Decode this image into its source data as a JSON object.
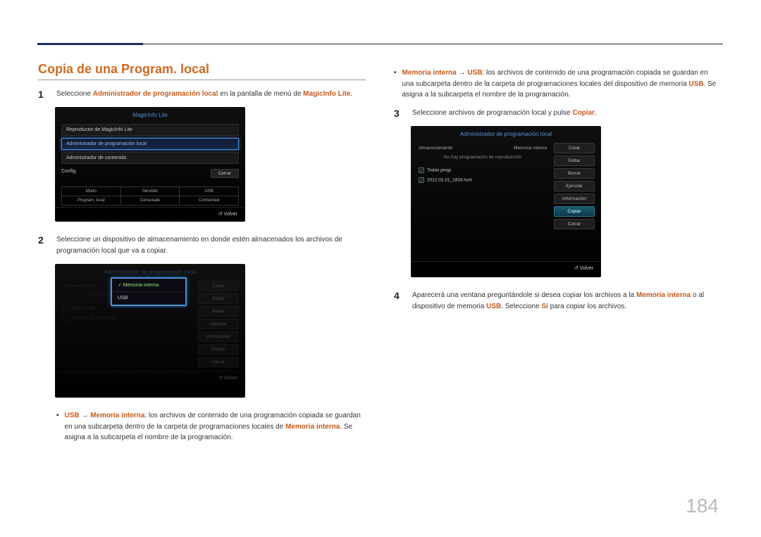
{
  "page_number": "184",
  "section_title": "Copia de una Program. local",
  "steps": {
    "s1_prefix": "Seleccione ",
    "s1_bold1": "Administrador de programación local",
    "s1_mid": " en la pantalla de menú de ",
    "s1_bold2": "MagicInfo Lite",
    "s1_end": ".",
    "s2": "Seleccione un dispositivo de almacenamiento en donde estén almacenados los archivos de programación local que va a copiar.",
    "s3_prefix": "Seleccione archivos de programación local y pulse ",
    "s3_copiar": "Copiar",
    "s3_end": ".",
    "s4_prefix": "Aparecerá una ventana preguntándole si desea copiar los archivos a la ",
    "s4_mem": "Memoria interna",
    "s4_mid": " o al dispositivo de memoria ",
    "s4_usb": "USB",
    "s4_mid2": ". Seleccione ",
    "s4_si": "Sí",
    "s4_end": " para copiar los archivos."
  },
  "bullets": {
    "b1_lead": "USB",
    "b1_arrow": " → ",
    "b1_target": "Memoria interna",
    "b1_rest": ": los archivos de contenido de una programación copiada se guardan en una subcarpeta dentro de la carpeta de programaciones locales de ",
    "b1_mem2": "Memoria interna",
    "b1_end": ". Se asigna a la subcarpeta el nombre de la programación.",
    "b2_lead": "Memoria interna",
    "b2_arrow": " → ",
    "b2_target": "USB",
    "b2_rest": ": los archivos de contenido de una programación copiada se guardan en una subcarpeta dentro de la carpeta de programaciones locales del dispositivo de memoria ",
    "b2_usb2": "USB",
    "b2_end": ". Se asigna a la subcarpeta el nombre de la programación."
  },
  "shot1": {
    "title": "MagicInfo Lite",
    "row1": "Reproductor de MagicInfo Lite",
    "row2": "Administrador de programación local",
    "row3": "Administrador de contenido",
    "row4": "Config.",
    "btn_cerrar": "Cerrar",
    "status_h": [
      "Modo",
      "Servidor",
      "USB"
    ],
    "status_v": [
      "Program. local",
      "Conectado",
      "Connected"
    ],
    "volver": "Volver"
  },
  "shot2": {
    "title": "Administrador de programación local",
    "hdr_left": "Almacenamiento",
    "hdr_right": "Memoria interna",
    "sub": "No hay programación de reproducción",
    "opt_all": "Todas progr.",
    "opt_file": "2012.01.01_1834.lsch",
    "pop_mem": "Memoria interna",
    "pop_usb": "USB",
    "btns": [
      "Crear",
      "Editar",
      "Borrar",
      "Ejecutar",
      "Información",
      "Copiar",
      "Cerrar"
    ],
    "volver": "Volver"
  },
  "shot3": {
    "title": "Administrador de programación local",
    "hdr_left": "Almacenamiento",
    "hdr_right": "Memoria interna",
    "sub": "No hay programación de reproducción",
    "opt_all": "Todas progr.",
    "opt_file": "2012.01.01_1834.lsch",
    "btns": [
      "Crear",
      "Editar",
      "Borrar",
      "Ejecutar",
      "Información",
      "Copiar",
      "Cerrar"
    ],
    "volver": "Volver"
  }
}
